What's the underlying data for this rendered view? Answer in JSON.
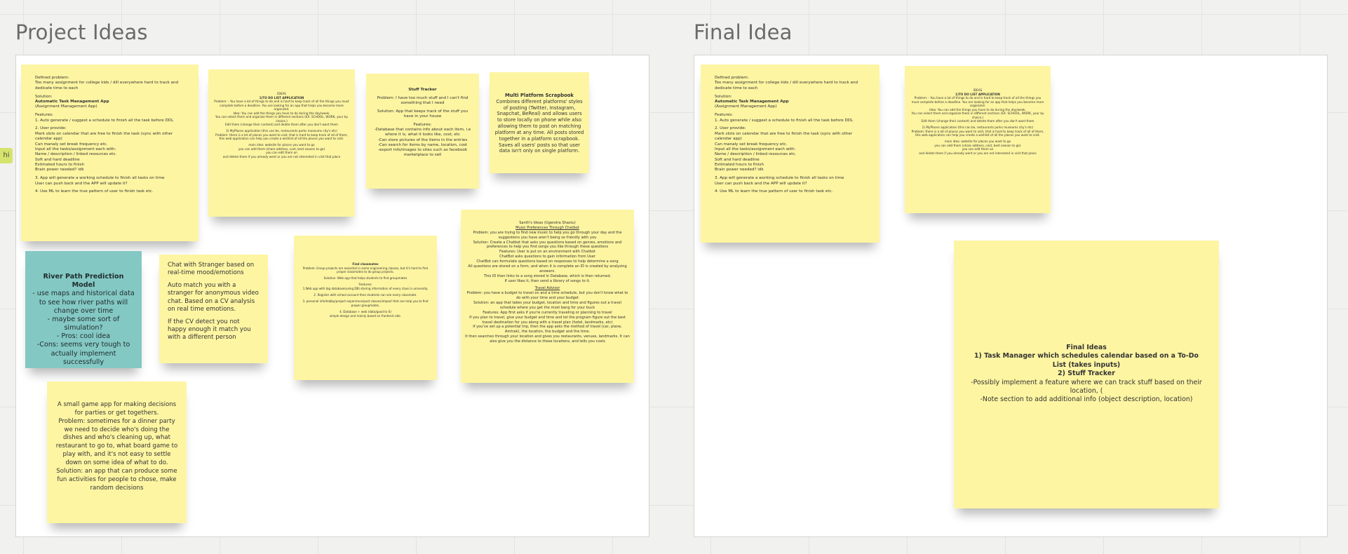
{
  "side_tab": "hi",
  "frames": {
    "left_title": "Project Ideas",
    "right_title": "Final Idea"
  },
  "notes": {
    "task_manager": [
      "Defined problem:",
      "Too many assignment for college kids / dill everywhere hard to track and dedicate time to each",
      "",
      "Solution:",
      "Automatic Task Management App",
      "(Assignment Management App)",
      "",
      "Features:",
      "1. Auto generate / suggest a schedule to finish all the task before DDL",
      "",
      "2. User provide:",
      "Mark slots on calendar that are free to finish the task (sync with other calendar app)",
      "Can manaly set break frequency etc.",
      "Input all the tasks/assignment each with:",
      "Name / description / linked resources etc.",
      "Soft and hard deadline",
      "Estimated hours to finish",
      "Brain power needed? idk",
      "",
      "3. App will generate a working schedule to finish all tasks on time",
      "User can push back and the APP will update it?",
      "",
      "4. Use ML to learn the true pattern of user to finish task etc."
    ],
    "ideas": [
      "IDEAS",
      "1)TO DO LIST APPLICATION",
      "Problem: - You have a lot of things to do and is hard to keep track of all the things you must complete before a deadline. You are looking for an app that helps you become more organized.",
      "Idea: You can add the things you have to do during the day/week.",
      "You can select them and organize them in different sections (EX. SCHOOL, WORK, your by choice.)",
      "Edit them (change their content) and delete them after you don't want them",
      "",
      "2) MyPlaces application (this can be, restaurants parks museums city's etc)",
      "Problem: there is a lot of places you want to visit, that is hard to keep track of all of them, this web application can help you create a wishlist of all the places you want to visit.",
      "",
      "main idea: website for places you want to go",
      "you can add them (share address, cost, best season to go)",
      "you can edit them an",
      "and delete them if you already went or you are not interested in visit that place"
    ],
    "stuff_tracker": [
      "Stuff Tracker",
      "",
      "Problem: I have too much stuff and I can't find something that I need",
      "",
      "Solution: App that keeps track of the stuff you have in your house",
      "",
      "Features:",
      "-Database that contains info about each item, i.e where it is, what it looks like, cost, etc",
      "-Can store pictures of the items in the entries",
      "-Can search for items by name, location, cost",
      "-export info/images to sites such as facebook marketplace to sell"
    ],
    "scrapbook": [
      "Multi Platform Scrapbook",
      "Combines different platforms' styles of posting (Twitter, Instagram, Snapchat, BeReal) and allows users to store locally on phone while also allowing them to post on matching platform at any time. All posts stored together in a platform scrapbook. Saves all users' posts so that user data isn't only on single platform."
    ],
    "river_path": [
      "River Path Prediction Model",
      "- use maps and historical data to see how river paths will change over time",
      "- maybe some sort of simulation?",
      "- Pros: cool idea",
      "-Cons: seems very tough to actually implement successfully"
    ],
    "chat_stranger": [
      "Chat with Stranger based on real-time mood/emotions",
      "",
      "Auto match you with a stranger for anonymous video chat. Based on a CV analysis on real time emotions.",
      "",
      "If the CV detect you not happy enough it match you with a different person"
    ],
    "find_classmates": [
      "Find classmates",
      "Problem: Group projects are essential in some engineering classes, but it's hard to find proper classmates to do group projects.",
      "",
      "Solution: Web app that helps students to find groupmates",
      "",
      "Features:",
      "1.Web app with big database(using DB) storing information of every class in university.",
      "",
      "2. Register with school account then students can see every classmate.",
      "",
      "3. personal info/hobby/project experience/past classes/impact that can help you to find proper groupmates.",
      "",
      "4. Database + web (data/good to 6)",
      "simple design and mainly based on frontend side."
    ],
    "santh": [
      "Santh's Ideas (Ugendra Shastu)",
      "Music Preferences Through Chatbot",
      "Problem: you are trying to find new music to help you go through your day and the suggestions you have aren't being so friendly with you",
      "Solution: Create a Chatbot that asks you questions based on genres, emotions and preferences to help you find songs you like through these questions",
      "Features: User is put on an environment with Chatbot",
      "ChatBot asks questions to gain information from User",
      "ChatBot can formulate questions based on responses to help determine a song",
      "All questions are stored on a form, and when it is complete an ID is created by analyzing answers.",
      "This ID then links to a song stored in Database, which is then returned.",
      "If user likes it, then send a library of songs to it.",
      "",
      "Travel Advisor",
      "Problem: you have a budget to travel on and a time schedule, but you don't know what to do with your time and your budget",
      "Solution: an app that takes your budget, location and time and figures out a travel schedule where you get the most bang for your buck",
      "Features: App first asks if you're currently traveling or planning to travel",
      "If you plan to travel, give your budget and time and let the program figure out the best travel destination for you along with a travel plan (hotel, landmarks, etc)",
      "If you've set up a potential trip, then the app asks the method of travel (car, plane, Amtrak), the location, the budget and the time.",
      "It then searches through your location and gives you restaurants, venues, landmarks. It can also give you the distance to these locations, and tells you costs"
    ],
    "game_app": [
      "A small game app for making decisions for parties or get togethers.",
      "Problem: sometimes for a dinner party we need to decide who's doing the dishes and who's cleaning up, what restaurant to go to, what board game to play with, and it's not easy to settle down on some idea of what to do.",
      "Solution: an app that can produce some fun activities for people to chose, make random decisions"
    ],
    "final_ideas": [
      "Final Ideas",
      "1) Task Manager which schedules calendar based on a To-Do List (takes inputs)",
      "2) Stuff Tracker",
      "-Possibly implement a feature where we can track stuff based on their location, (",
      "-Note section to add additional info (object description, location)"
    ]
  }
}
